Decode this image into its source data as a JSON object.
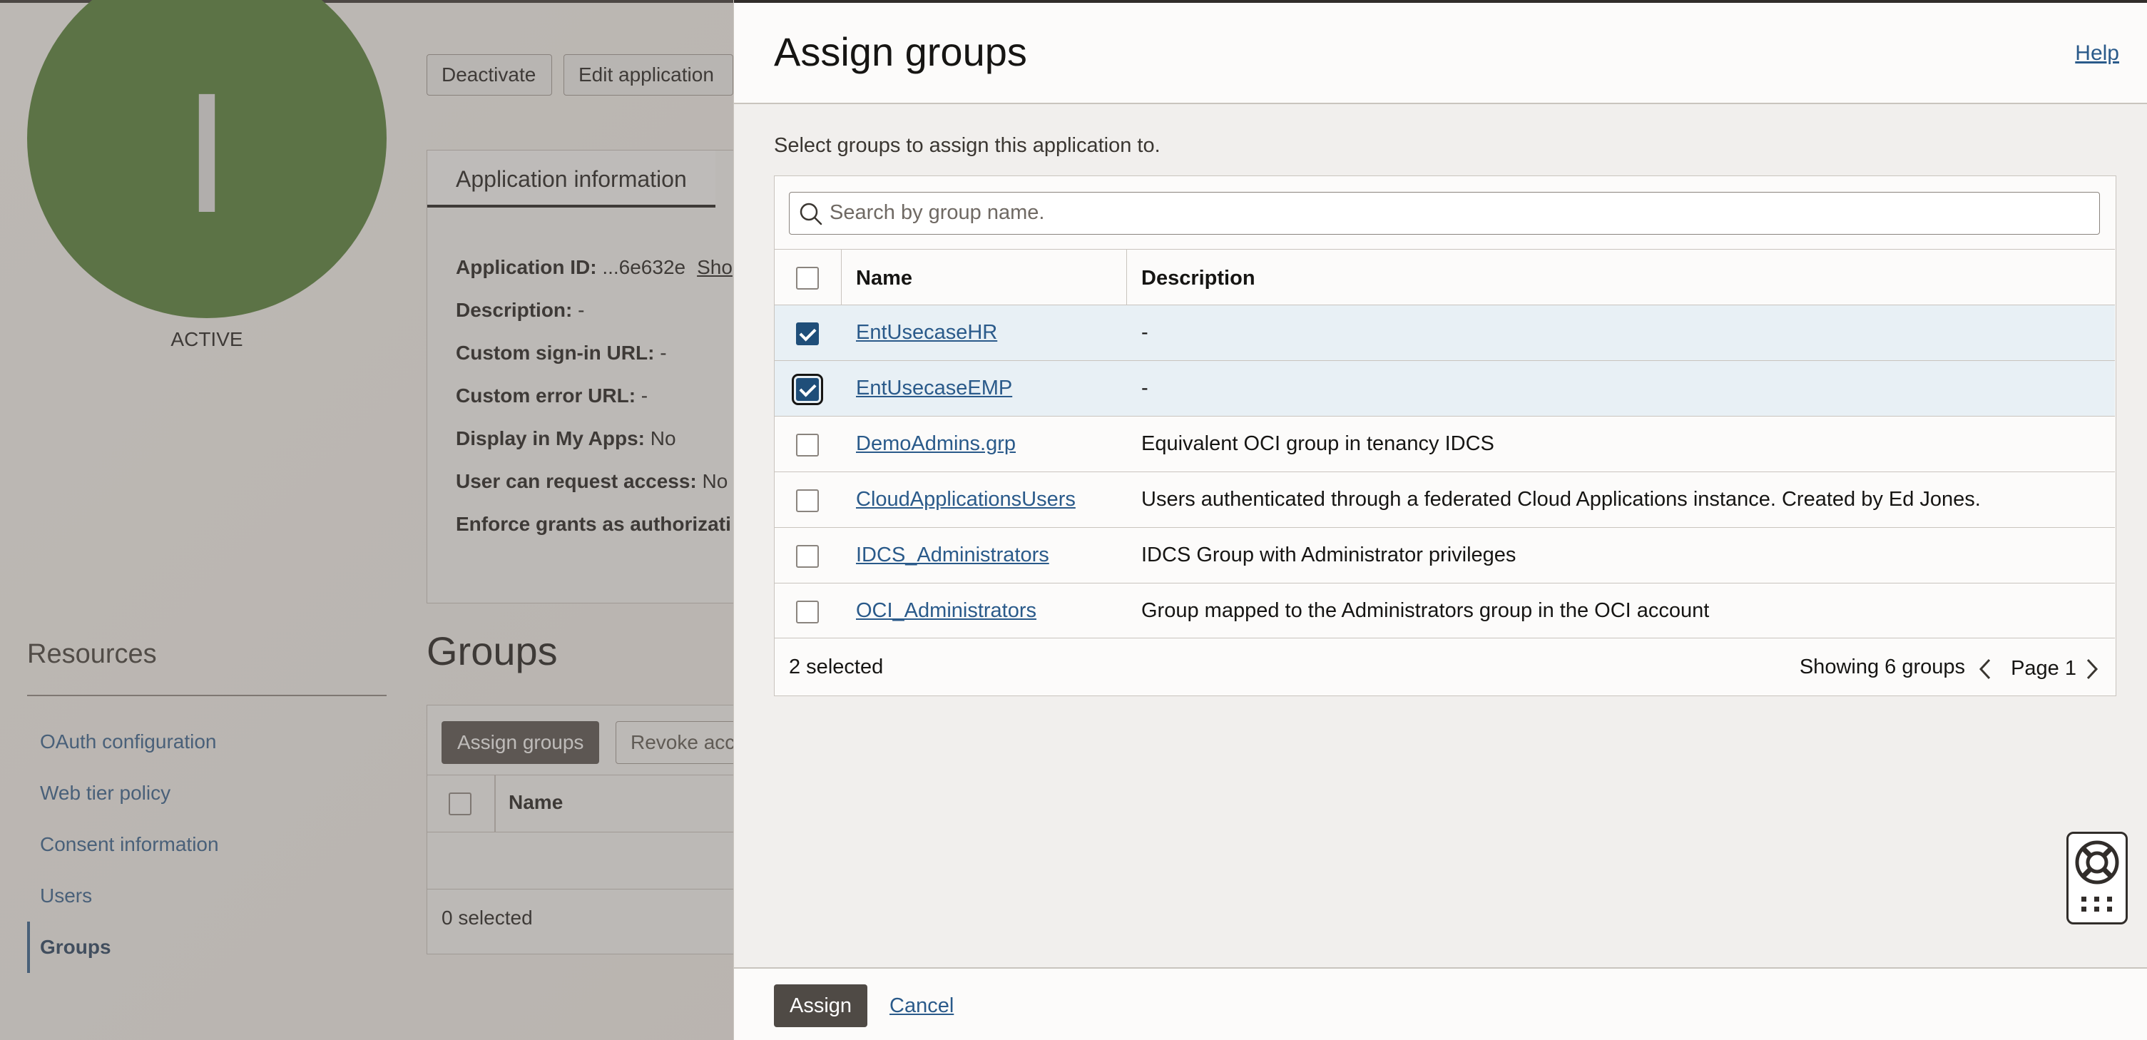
{
  "background": {
    "avatar_letter": "I",
    "status": "ACTIVE",
    "buttons": {
      "deactivate": "Deactivate",
      "edit_application": "Edit application"
    },
    "info_tab": "Application information",
    "info_rows": [
      {
        "label": "Application ID:",
        "value": "...6e632e",
        "link": "Sho"
      },
      {
        "label": "Description:",
        "value": "-"
      },
      {
        "label": "Custom sign-in URL:",
        "value": "-"
      },
      {
        "label": "Custom error URL:",
        "value": "-"
      },
      {
        "label": "Display in My Apps:",
        "value": "No"
      },
      {
        "label": "User can request access:",
        "value": "No"
      },
      {
        "label": "Enforce grants as authorizati",
        "value": ""
      }
    ],
    "resources": {
      "title": "Resources",
      "items": [
        {
          "label": "OAuth configuration"
        },
        {
          "label": "Web tier policy"
        },
        {
          "label": "Consent information"
        },
        {
          "label": "Users"
        },
        {
          "label": "Groups",
          "selected": true
        }
      ]
    },
    "groups": {
      "heading": "Groups",
      "assign_button": "Assign groups",
      "revoke_button": "Revoke acc",
      "name_header": "Name",
      "selected_count": "0 selected"
    }
  },
  "drawer": {
    "title": "Assign groups",
    "help": "Help",
    "description": "Select groups to assign this application to.",
    "search_placeholder": "Search by group name.",
    "columns": {
      "name": "Name",
      "description": "Description"
    },
    "rows": [
      {
        "name": "EntUsecaseHR",
        "description": "-",
        "checked": true
      },
      {
        "name": "EntUsecaseEMP",
        "description": "-",
        "checked": true
      },
      {
        "name": "DemoAdmins.grp",
        "description": "Equivalent OCI group in tenancy IDCS",
        "checked": false
      },
      {
        "name": "CloudApplicationsUsers",
        "description": "Users authenticated through a federated Cloud Applications instance. Created by Ed Jones.",
        "checked": false
      },
      {
        "name": "IDCS_Administrators",
        "description": "IDCS Group with Administrator privileges",
        "checked": false
      },
      {
        "name": "OCI_Administrators",
        "description": "Group mapped to the Administrators group in the OCI account",
        "checked": false
      }
    ],
    "selected_count": "2 selected",
    "showing": "Showing 6 groups",
    "page": "Page 1",
    "assign": "Assign",
    "cancel": "Cancel"
  },
  "colors": {
    "accent_link": "#2a5a8a",
    "checkbox_checked": "#1f4e79",
    "avatar": "#4e7c2e",
    "primary_button": "#4f4a45"
  }
}
